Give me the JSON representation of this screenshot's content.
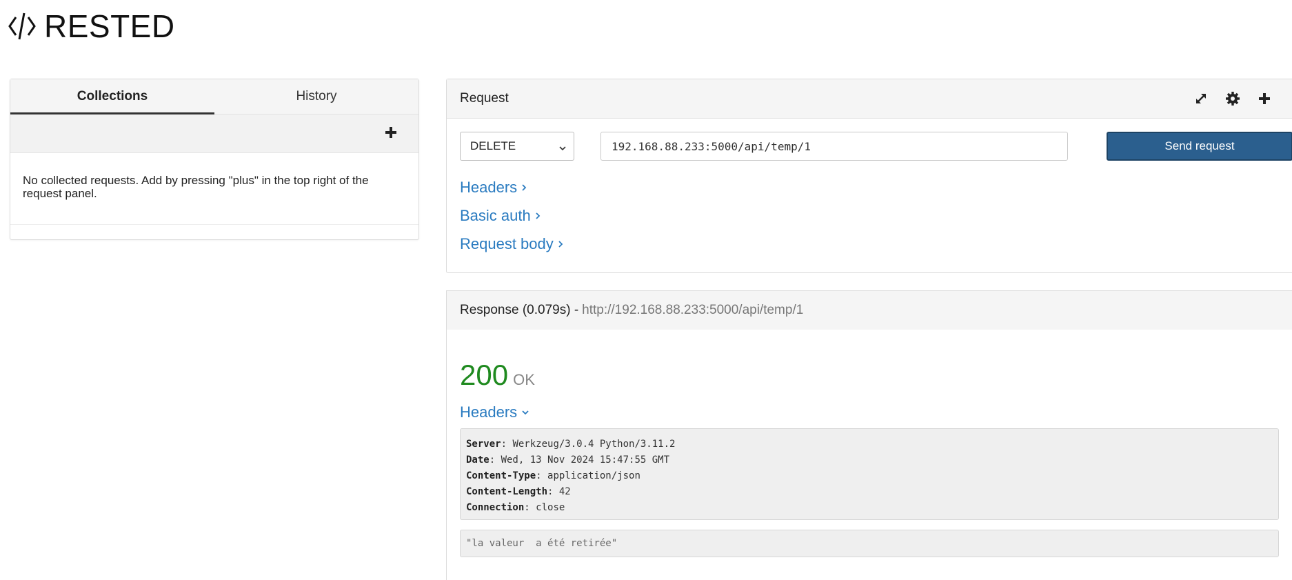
{
  "app": {
    "title": "RESTED",
    "logo_icon": "code-brackets-icon"
  },
  "sidebar": {
    "tabs": [
      {
        "label": "Collections",
        "active": true
      },
      {
        "label": "History",
        "active": false
      }
    ],
    "add_icon": "plus-icon",
    "empty_message": "No collected requests. Add by pressing \"plus\" in the top right of the request panel."
  },
  "request": {
    "title": "Request",
    "icons": [
      "expand-icon",
      "gear-icon",
      "plus-icon"
    ],
    "method": "DELETE",
    "url": "192.168.88.233:5000/api/temp/1",
    "send_label": "Send request",
    "links": [
      {
        "label": "Headers"
      },
      {
        "label": "Basic auth"
      },
      {
        "label": "Request body"
      }
    ]
  },
  "response": {
    "title_prefix": "Response (0.079s) -",
    "url": "http://192.168.88.233:5000/api/temp/1",
    "status_code": "200",
    "status_text": "OK",
    "headers_label": "Headers",
    "headers": [
      {
        "key": "Server",
        "value": "Werkzeug/3.0.4 Python/3.11.2"
      },
      {
        "key": "Date",
        "value": "Wed, 13 Nov 2024 15:47:55 GMT"
      },
      {
        "key": "Content-Type",
        "value": "application/json"
      },
      {
        "key": "Content-Length",
        "value": "42"
      },
      {
        "key": "Connection",
        "value": "close"
      }
    ],
    "body": "\"la valeur  a été retirée\""
  },
  "colors": {
    "accent": "#2b5f8e",
    "link": "#2a7bc0",
    "success": "#1f8a1f"
  }
}
